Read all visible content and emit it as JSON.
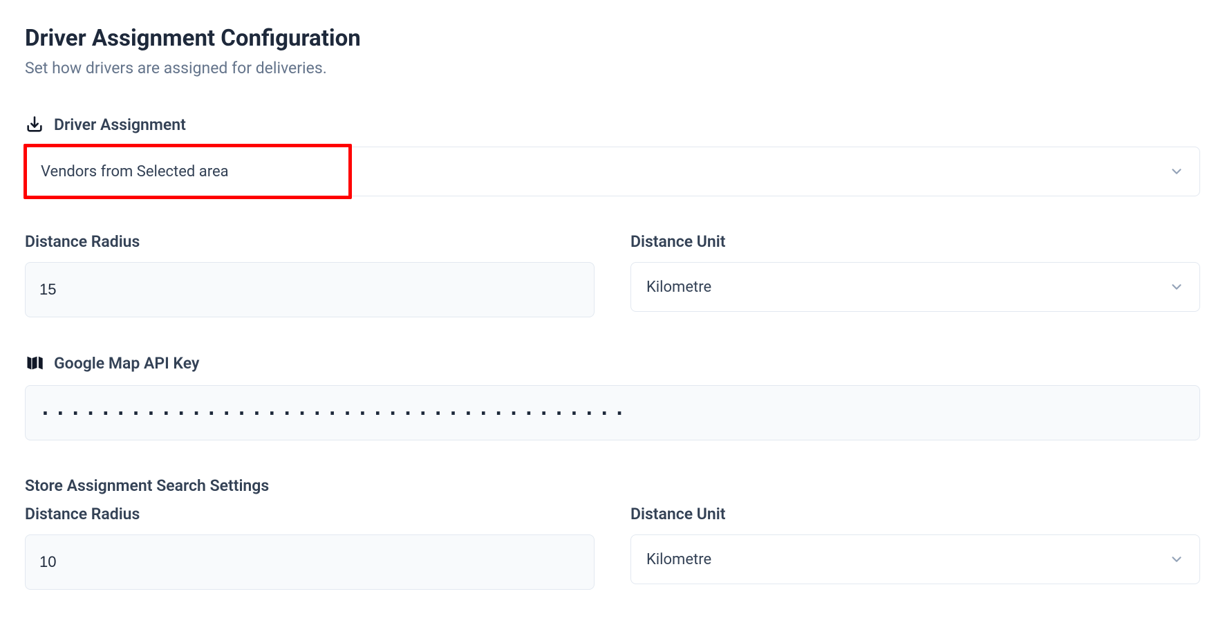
{
  "header": {
    "title": "Driver Assignment Configuration",
    "subtitle": "Set how drivers are assigned for deliveries."
  },
  "driver_assignment": {
    "label": "Driver Assignment",
    "selected": "Vendors from Selected area"
  },
  "distance_radius": {
    "label": "Distance Radius",
    "value": "15"
  },
  "distance_unit": {
    "label": "Distance Unit",
    "selected": "Kilometre"
  },
  "api_key": {
    "label": "Google Map API Key",
    "masked": "·······································"
  },
  "store_search": {
    "title": "Store Assignment Search Settings",
    "distance_radius": {
      "label": "Distance Radius",
      "value": "10"
    },
    "distance_unit": {
      "label": "Distance Unit",
      "selected": "Kilometre"
    }
  }
}
